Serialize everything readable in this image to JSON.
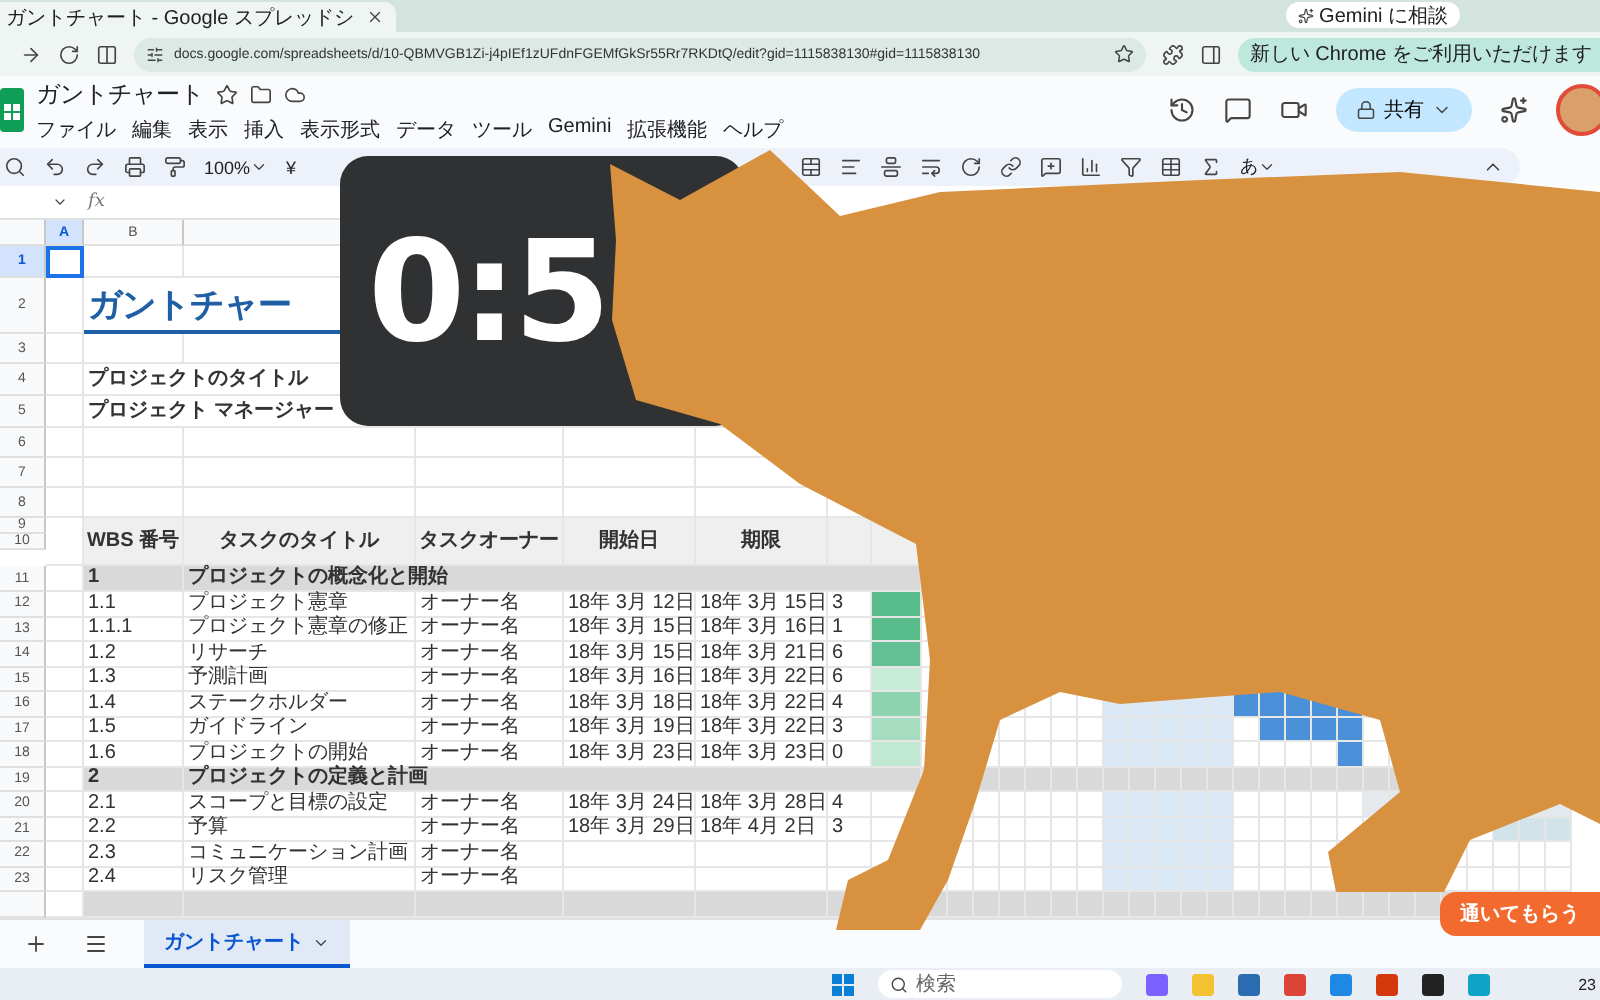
{
  "browser": {
    "tab_title": "ガントチャート - Google スプレッドシ",
    "gemini_button": "Gemini に相談",
    "url": "docs.google.com/spreadsheets/d/10-QBMVGB1Zi-j4pIEf1zUFdnFGEMfGkSr55Rr7RKDtQ/edit?gid=1115838130#gid=1115838130",
    "chrome_notice": "新しい Chrome をご利用いただけます"
  },
  "doc": {
    "title": "ガントチャート",
    "menu": [
      "ファイル",
      "編集",
      "表示",
      "挿入",
      "表示形式",
      "データ",
      "ツール",
      "Gemini",
      "拡張機能",
      "ヘルプ"
    ],
    "share_button": "共有"
  },
  "toolbar": {
    "zoom": "100%",
    "currency": "¥",
    "input_mode": "あ"
  },
  "formula_bar": {
    "label": "fx"
  },
  "sheet": {
    "columns": [
      {
        "label": "A",
        "selected": true
      },
      {
        "label": "B",
        "selected": false
      }
    ],
    "row_numbers": [
      {
        "label": "1",
        "selected": true
      },
      {
        "label": "2",
        "selected": false
      },
      {
        "label": "3",
        "selected": false
      },
      {
        "label": "4",
        "selected": false
      },
      {
        "label": "5",
        "selected": false
      },
      {
        "label": "6",
        "selected": false
      },
      {
        "label": "7",
        "selected": false
      },
      {
        "label": "8",
        "selected": false
      },
      {
        "label": "9",
        "selected": false
      },
      {
        "label": "10",
        "selected": false
      },
      {
        "label": "11",
        "selected": false
      },
      {
        "label": "12",
        "selected": false
      },
      {
        "label": "13",
        "selected": false
      },
      {
        "label": "14",
        "selected": false
      },
      {
        "label": "15",
        "selected": false
      },
      {
        "label": "16",
        "selected": false
      },
      {
        "label": "17",
        "selected": false
      },
      {
        "label": "18",
        "selected": false
      },
      {
        "label": "19",
        "selected": false
      },
      {
        "label": "20",
        "selected": false
      },
      {
        "label": "21",
        "selected": false
      },
      {
        "label": "22",
        "selected": false
      },
      {
        "label": "23",
        "selected": false
      }
    ],
    "title": "ガントチャー",
    "info_labels": [
      "プロジェクトのタイトル",
      "プロジェクト マネージャー"
    ],
    "table_headers": [
      "WBS 番号",
      "タスクのタイトル",
      "タスクオーナー",
      "開始日",
      "期限"
    ],
    "rows": [
      {
        "kind": "group",
        "wbs": "1",
        "title": "プロジェクトの概念化と開始"
      },
      {
        "kind": "task",
        "wbs": "1.1",
        "title": "プロジェクト憲章",
        "owner": "オーナー名",
        "start": "18年 3月 12日",
        "end": "18年 3月 15日",
        "days": "3",
        "color": "#57bb8a"
      },
      {
        "kind": "task",
        "wbs": "1.1.1",
        "title": "プロジェクト憲章の修正",
        "owner": "オーナー名",
        "start": "18年 3月 15日",
        "end": "18年 3月 16日",
        "days": "1",
        "color": "#57bb8a"
      },
      {
        "kind": "task",
        "wbs": "1.2",
        "title": "リサーチ",
        "owner": "オーナー名",
        "start": "18年 3月 15日",
        "end": "18年 3月 21日",
        "days": "6",
        "color": "#63c094"
      },
      {
        "kind": "task",
        "wbs": "1.3",
        "title": "予測計画",
        "owner": "オーナー名",
        "start": "18年 3月 16日",
        "end": "18年 3月 22日",
        "days": "6",
        "color": "#c9ebd9"
      },
      {
        "kind": "task",
        "wbs": "1.4",
        "title": "ステークホルダー",
        "owner": "オーナー名",
        "start": "18年 3月 18日",
        "end": "18年 3月 22日",
        "days": "4",
        "color": "#8ed3b0"
      },
      {
        "kind": "task",
        "wbs": "1.5",
        "title": "ガイドライン",
        "owner": "オーナー名",
        "start": "18年 3月 19日",
        "end": "18年 3月 22日",
        "days": "3",
        "color": "#a6dcc0"
      },
      {
        "kind": "task",
        "wbs": "1.6",
        "title": "プロジェクトの開始",
        "owner": "オーナー名",
        "start": "18年 3月 23日",
        "end": "18年 3月 23日",
        "days": "0",
        "color": "#c0e8d3"
      },
      {
        "kind": "group",
        "wbs": "2",
        "title": "プロジェクトの定義と計画"
      },
      {
        "kind": "task",
        "wbs": "2.1",
        "title": "スコープと目標の設定",
        "owner": "オーナー名",
        "start": "18年 3月 24日",
        "end": "18年 3月 28日",
        "days": "4"
      },
      {
        "kind": "task",
        "wbs": "2.2",
        "title": "予算",
        "owner": "オーナー名",
        "start": "18年 3月 29日",
        "end": "18年 4月 2日",
        "days": "3"
      },
      {
        "kind": "task",
        "wbs": "2.3",
        "title": "コミュニケーション計画",
        "owner": "オーナー名"
      },
      {
        "kind": "task",
        "wbs": "2.4",
        "title": "リスク管理",
        "owner": "オーナー名"
      }
    ]
  },
  "sheet_tabs": [
    {
      "label": "ガントチャート",
      "selected": true
    }
  ],
  "timer": "0:5",
  "help_button": "通いてもらう",
  "taskbar": {
    "search_placeholder": "検索",
    "clock": "23"
  }
}
